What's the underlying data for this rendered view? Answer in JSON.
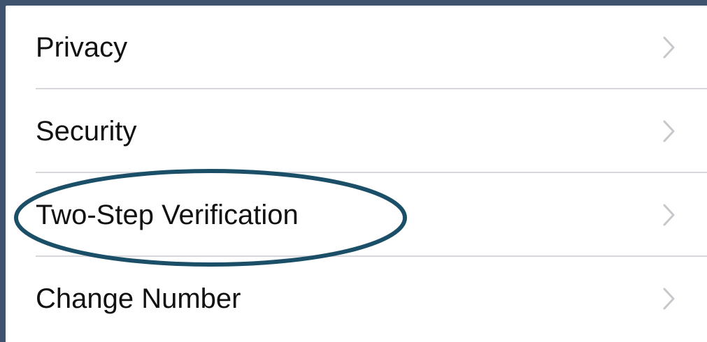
{
  "settings": {
    "items": [
      {
        "label": "Privacy"
      },
      {
        "label": "Security"
      },
      {
        "label": "Two-Step Verification"
      },
      {
        "label": "Change Number"
      }
    ]
  },
  "chevron_icon": "chevron-right-icon",
  "colors": {
    "background_frame": "#3f536f",
    "panel": "#ffffff",
    "text": "#111111",
    "separator": "#d7d7dc",
    "chevron": "#c7c7cc",
    "highlight_ellipse": "#1b4f68"
  }
}
